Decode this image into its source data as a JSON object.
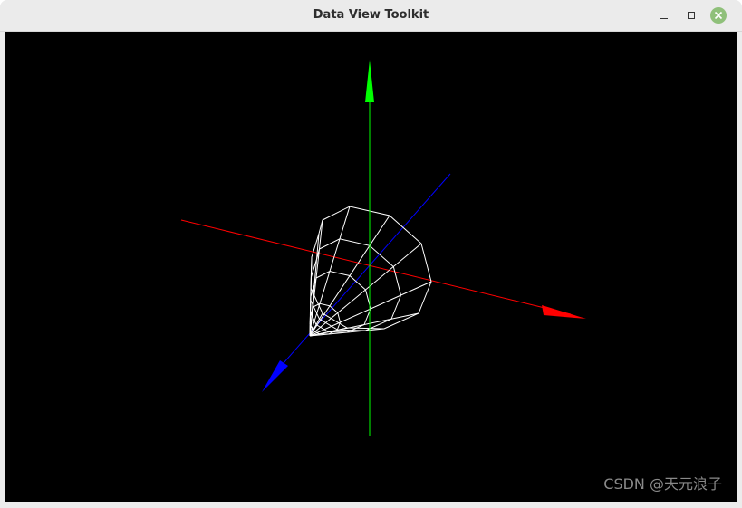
{
  "window": {
    "title": "Data View Toolkit",
    "controls": {
      "minimize": "minimize",
      "maximize": "maximize",
      "close": "close"
    },
    "close_color": "#8fc07a"
  },
  "viewport": {
    "background": "#000000",
    "axes": {
      "x": {
        "color": "#ff0000"
      },
      "y": {
        "color": "#00ff00"
      },
      "z": {
        "color": "#0000ff"
      }
    },
    "mesh": {
      "type": "cone-wireframe",
      "color": "#ffffff"
    }
  },
  "watermark": {
    "text": "CSDN @天元浪子"
  }
}
